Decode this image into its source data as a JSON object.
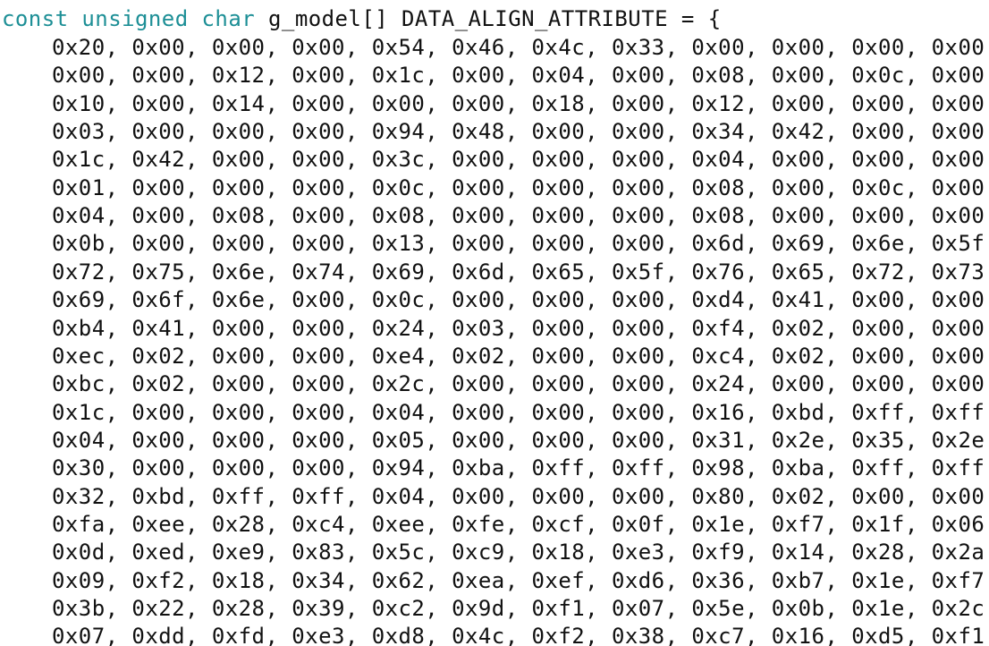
{
  "colors": {
    "keyword": "#1d8f96",
    "text": "#111111",
    "background": "#ffffff"
  },
  "declaration": {
    "keyword_const": "const",
    "space1": " ",
    "keyword_unsigned": "unsigned",
    "space2": " ",
    "keyword_char": "char",
    "rest": " g_model[] DATA_ALIGN_ATTRIBUTE = {"
  },
  "rows": [
    [
      "0x20",
      "0x00",
      "0x00",
      "0x00",
      "0x54",
      "0x46",
      "0x4c",
      "0x33",
      "0x00",
      "0x00",
      "0x00",
      "0x00"
    ],
    [
      "0x00",
      "0x00",
      "0x12",
      "0x00",
      "0x1c",
      "0x00",
      "0x04",
      "0x00",
      "0x08",
      "0x00",
      "0x0c",
      "0x00"
    ],
    [
      "0x10",
      "0x00",
      "0x14",
      "0x00",
      "0x00",
      "0x00",
      "0x18",
      "0x00",
      "0x12",
      "0x00",
      "0x00",
      "0x00"
    ],
    [
      "0x03",
      "0x00",
      "0x00",
      "0x00",
      "0x94",
      "0x48",
      "0x00",
      "0x00",
      "0x34",
      "0x42",
      "0x00",
      "0x00"
    ],
    [
      "0x1c",
      "0x42",
      "0x00",
      "0x00",
      "0x3c",
      "0x00",
      "0x00",
      "0x00",
      "0x04",
      "0x00",
      "0x00",
      "0x00"
    ],
    [
      "0x01",
      "0x00",
      "0x00",
      "0x00",
      "0x0c",
      "0x00",
      "0x00",
      "0x00",
      "0x08",
      "0x00",
      "0x0c",
      "0x00"
    ],
    [
      "0x04",
      "0x00",
      "0x08",
      "0x00",
      "0x08",
      "0x00",
      "0x00",
      "0x00",
      "0x08",
      "0x00",
      "0x00",
      "0x00"
    ],
    [
      "0x0b",
      "0x00",
      "0x00",
      "0x00",
      "0x13",
      "0x00",
      "0x00",
      "0x00",
      "0x6d",
      "0x69",
      "0x6e",
      "0x5f"
    ],
    [
      "0x72",
      "0x75",
      "0x6e",
      "0x74",
      "0x69",
      "0x6d",
      "0x65",
      "0x5f",
      "0x76",
      "0x65",
      "0x72",
      "0x73"
    ],
    [
      "0x69",
      "0x6f",
      "0x6e",
      "0x00",
      "0x0c",
      "0x00",
      "0x00",
      "0x00",
      "0xd4",
      "0x41",
      "0x00",
      "0x00"
    ],
    [
      "0xb4",
      "0x41",
      "0x00",
      "0x00",
      "0x24",
      "0x03",
      "0x00",
      "0x00",
      "0xf4",
      "0x02",
      "0x00",
      "0x00"
    ],
    [
      "0xec",
      "0x02",
      "0x00",
      "0x00",
      "0xe4",
      "0x02",
      "0x00",
      "0x00",
      "0xc4",
      "0x02",
      "0x00",
      "0x00"
    ],
    [
      "0xbc",
      "0x02",
      "0x00",
      "0x00",
      "0x2c",
      "0x00",
      "0x00",
      "0x00",
      "0x24",
      "0x00",
      "0x00",
      "0x00"
    ],
    [
      "0x1c",
      "0x00",
      "0x00",
      "0x00",
      "0x04",
      "0x00",
      "0x00",
      "0x00",
      "0x16",
      "0xbd",
      "0xff",
      "0xff"
    ],
    [
      "0x04",
      "0x00",
      "0x00",
      "0x00",
      "0x05",
      "0x00",
      "0x00",
      "0x00",
      "0x31",
      "0x2e",
      "0x35",
      "0x2e"
    ],
    [
      "0x30",
      "0x00",
      "0x00",
      "0x00",
      "0x94",
      "0xba",
      "0xff",
      "0xff",
      "0x98",
      "0xba",
      "0xff",
      "0xff"
    ],
    [
      "0x32",
      "0xbd",
      "0xff",
      "0xff",
      "0x04",
      "0x00",
      "0x00",
      "0x00",
      "0x80",
      "0x02",
      "0x00",
      "0x00"
    ],
    [
      "0xfa",
      "0xee",
      "0x28",
      "0xc4",
      "0xee",
      "0xfe",
      "0xcf",
      "0x0f",
      "0x1e",
      "0xf7",
      "0x1f",
      "0x06"
    ],
    [
      "0x0d",
      "0xed",
      "0xe9",
      "0x83",
      "0x5c",
      "0xc9",
      "0x18",
      "0xe3",
      "0xf9",
      "0x14",
      "0x28",
      "0x2a"
    ],
    [
      "0x09",
      "0xf2",
      "0x18",
      "0x34",
      "0x62",
      "0xea",
      "0xef",
      "0xd6",
      "0x36",
      "0xb7",
      "0x1e",
      "0xf7"
    ],
    [
      "0x3b",
      "0x22",
      "0x28",
      "0x39",
      "0xc2",
      "0x9d",
      "0xf1",
      "0x07",
      "0x5e",
      "0x0b",
      "0x1e",
      "0x2c"
    ],
    [
      "0x07",
      "0xdd",
      "0xfd",
      "0xe3",
      "0xd8",
      "0x4c",
      "0xf2",
      "0x38",
      "0xc7",
      "0x16",
      "0xd5",
      "0xf1"
    ]
  ],
  "separator": ", "
}
